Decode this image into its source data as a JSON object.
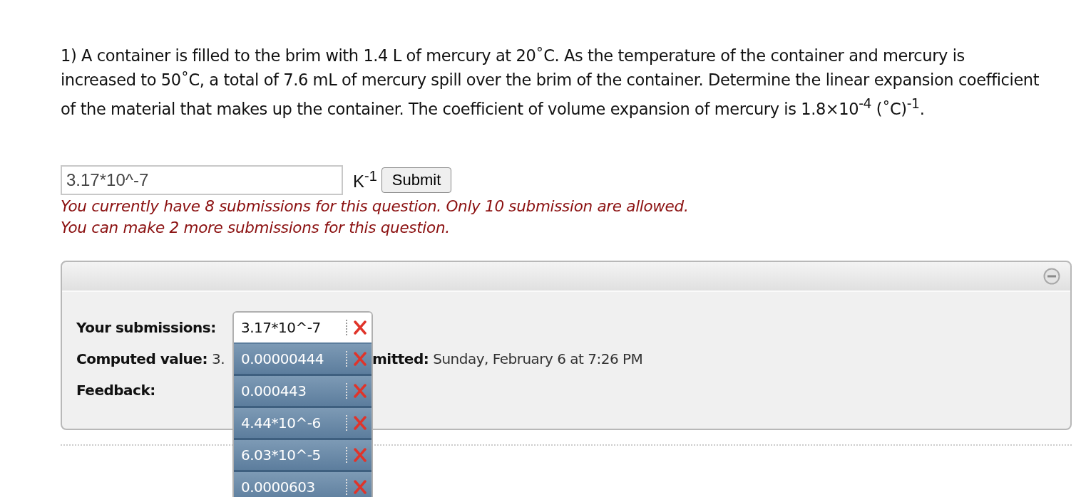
{
  "question": {
    "text": "1) A container is filled to the brim with 1.4 L of mercury at 20˚C. As the temperature of the container and mercury is increased to 50˚C, a total of 7.6 mL of mercury spill over the brim of the container. Determine the linear expansion coefficient of the material that makes up the container. The coefficient of volume expansion of mercury is 1.8×10$^{-4}$ (˚C)$^{-1}$."
  },
  "answer": {
    "value": "3.17*10^-7",
    "unit": "K$^{-1}$",
    "submit_label": "Submit"
  },
  "messages": [
    "You currently have 8 submissions for this question. Only 10 submission are allowed.",
    "You can make 2 more submissions for this question."
  ],
  "panel": {
    "expanded": true,
    "submissions_label": "Your submissions:",
    "computed_label": "Computed value:",
    "computed_value": "3.",
    "submitted_label": "mitted:",
    "submitted_value": "Sunday, February 6 at 7:26 PM",
    "feedback_label": "Feedback:",
    "submissions": [
      {
        "value": "3.17*10^-7",
        "selected": true
      },
      {
        "value": "0.00000444",
        "selected": false
      },
      {
        "value": "0.000443",
        "selected": false
      },
      {
        "value": "4.44*10^-6",
        "selected": false
      },
      {
        "value": "6.03*10^-5",
        "selected": false
      },
      {
        "value": "0.0000603",
        "selected": false
      }
    ]
  }
}
